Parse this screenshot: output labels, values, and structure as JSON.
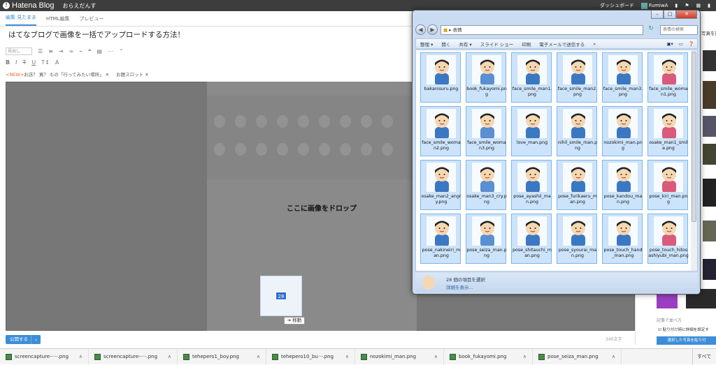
{
  "topbar": {
    "logo": "Hatena Blog",
    "blog_name": "おらえだんす",
    "dashboard": "ダッシュボード",
    "user": "FumiwA"
  },
  "editor": {
    "tabs": [
      {
        "label": "編集 見たまま"
      },
      {
        "label": "HTML編集"
      },
      {
        "label": "プレビュー"
      }
    ],
    "title": "はてなブログで画像を一括でアップロードする方法！",
    "format_select": "見出し",
    "tags": {
      "new": "<NEW>",
      "tag1": "お店？ 買？ もの「行ってみたい場所」",
      "tag2": "お題スロット"
    },
    "drop_text": "ここに画像をドロップ",
    "drag_count": "28",
    "move_label": "➔ 移動",
    "publish": "公開する",
    "char_count": "340文字"
  },
  "right_panel": {
    "header": "写真を投稿",
    "footer_text": "記事で並べ方",
    "checkbox_label": "貼り付け時に詳細を設定す",
    "button": "選択した写真を貼り付"
  },
  "explorer": {
    "address": "表情",
    "search_placeholder": "表情の検索",
    "toolbar": [
      "整理 ▾",
      "開く",
      "共有 ▾",
      "スライド ショー",
      "印刷",
      "電子メールで送信する",
      "»"
    ],
    "files": [
      "bakanisuru.png",
      "book_fukayomi.png",
      "face_smile_man1.png",
      "face_smile_man2.png",
      "face_smile_man3.png",
      "face_smile_woman1.png",
      "face_smile_woman2.png",
      "face_smile_woman3.png",
      "love_man.png",
      "nihil_smile_man.png",
      "nozokimi_man.png",
      "osake_man1_smile.png",
      "osake_man2_angry.png",
      "osake_man3_cry.png",
      "pose_ayashii_man.png",
      "pose_furikaeru_man.png",
      "pose_kandou_man.png",
      "pose_kiri_man.png",
      "pose_nakineiri_man.png",
      "pose_seiza_man.png",
      "pose_shitauchi_man.png",
      "pose_syourai_man.png",
      "pose_touch_hand_man.png",
      "pose_touch_hitosashiyubi_man.png"
    ],
    "status_selected": "28 個の項目を選択",
    "status_details": "詳細を表示..."
  },
  "taskbar": {
    "items": [
      "screencapture-····.png",
      "screencapture-····.png",
      "tehepero1_boy.png",
      "tehepero10_bu···.png",
      "nozokimi_man.png",
      "book_fukayomi.png",
      "pose_seiza_man.png"
    ],
    "all": "すべて"
  }
}
